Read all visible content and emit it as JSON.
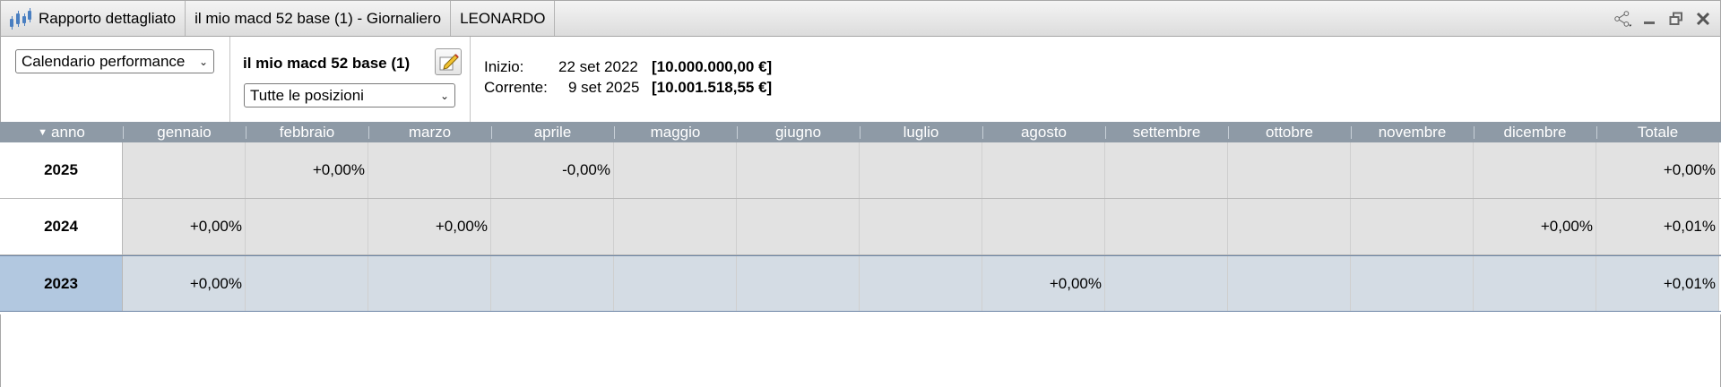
{
  "window": {
    "report_title": "Rapporto dettagliato",
    "strategy_title": "il mio macd 52 base (1) - Giornaliero",
    "instrument": "LEONARDO",
    "icons": [
      "candlestick-icon",
      "share-icon",
      "minimize-icon",
      "restore-icon",
      "close-icon"
    ]
  },
  "controls": {
    "view_select": "Calendario performance",
    "strategy_name": "il mio macd 52 base (1)",
    "positions_select": "Tutte le posizioni",
    "start_label": "Inizio:",
    "start_date": "22 set 2022",
    "start_value": "[10.000.000,00 €]",
    "current_label": "Corrente:",
    "current_date": "9 set 2025",
    "current_value": "[10.001.518,55 €]"
  },
  "table": {
    "sort_arrow": "▼",
    "columns": [
      "anno",
      "gennaio",
      "febbraio",
      "marzo",
      "aprile",
      "maggio",
      "giugno",
      "luglio",
      "agosto",
      "settembre",
      "ottobre",
      "novembre",
      "dicembre",
      "Totale"
    ],
    "rows": [
      {
        "year": "2025",
        "cells": [
          "",
          "+0,00%",
          "",
          "-0,00%",
          "",
          "",
          "",
          "",
          "",
          "",
          "",
          "",
          "+0,00%"
        ],
        "selected": false
      },
      {
        "year": "2024",
        "cells": [
          "+0,00%",
          "",
          "+0,00%",
          "",
          "",
          "",
          "",
          "",
          "",
          "",
          "",
          "+0,00%",
          "+0,01%"
        ],
        "selected": false
      },
      {
        "year": "2023",
        "cells": [
          "+0,00%",
          "",
          "",
          "",
          "",
          "",
          "",
          "+0,00%",
          "",
          "",
          "",
          "",
          "+0,01%"
        ],
        "selected": true
      }
    ]
  },
  "colors": {
    "header_bg": "#8e9aa6",
    "cell_bg": "#e2e2e2",
    "selected_row_bg": "#d4dce4",
    "selected_year_bg": "#b2c8e0",
    "icon_blue": "#4a7fc1"
  }
}
